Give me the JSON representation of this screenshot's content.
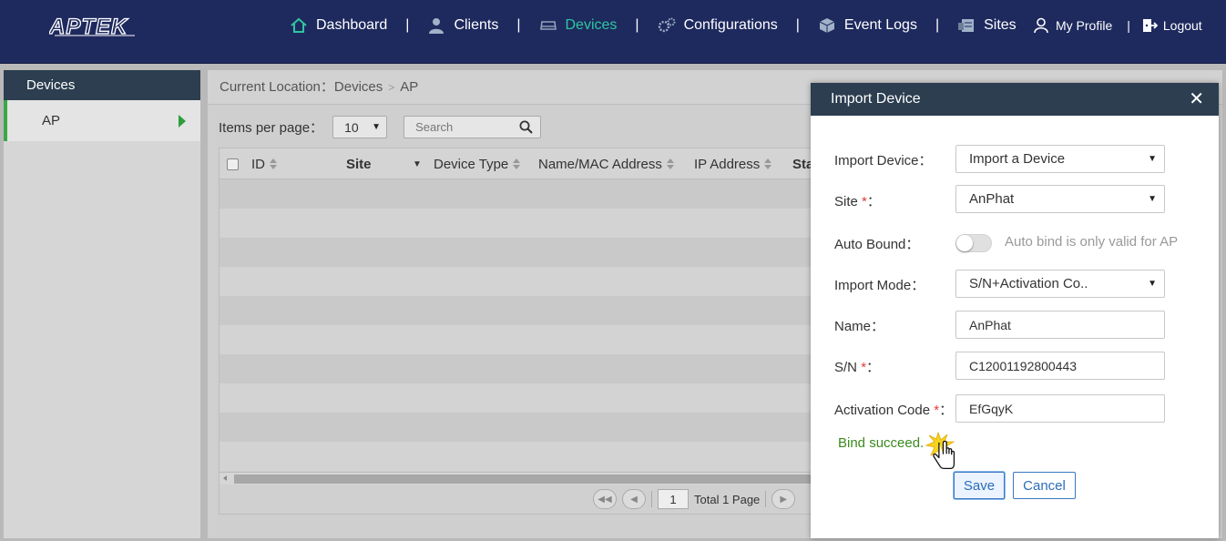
{
  "header": {
    "logo_text": "APTEK",
    "nav": [
      {
        "label": "Dashboard",
        "icon": "home-icon"
      },
      {
        "label": "Clients",
        "icon": "user-icon"
      },
      {
        "label": "Devices",
        "icon": "device-icon",
        "active": true
      },
      {
        "label": "Configurations",
        "icon": "gears-icon"
      },
      {
        "label": "Event Logs",
        "icon": "cube-icon"
      },
      {
        "label": "Sites",
        "icon": "sites-icon"
      }
    ],
    "my_profile": "My Profile",
    "logout": "Logout",
    "accent_color": "#2ec6a0"
  },
  "sidebar": {
    "title": "Devices",
    "items": [
      {
        "label": "AP"
      }
    ]
  },
  "main": {
    "breadcrumb_prefix": "Current Location：",
    "breadcrumb": [
      "Devices",
      "AP"
    ],
    "items_per_page_label": "Items per page：",
    "items_per_page_value": "10",
    "search_placeholder": "Search",
    "columns": [
      "ID",
      "Site",
      "Device Type",
      "Name/MAC Address",
      "IP Address",
      "Sta"
    ],
    "pager": {
      "current_page": "1",
      "total_label": "Total 1 Page"
    }
  },
  "modal": {
    "title": "Import Device",
    "fields": {
      "import_device_label": "Import Device：",
      "import_device_value": "Import a Device",
      "site_label": "Site",
      "site_value": "AnPhat",
      "auto_bound_label": "Auto Bound：",
      "auto_bound_hint": "Auto bind is only valid for AP",
      "import_mode_label": "Import Mode：",
      "import_mode_value": "S/N+Activation Co..",
      "name_label": "Name：",
      "name_value": "AnPhat",
      "sn_label": "S/N",
      "sn_value": "C12001192800443",
      "activation_label": "Activation Code",
      "activation_value": "EfGqyK"
    },
    "required_mark": "*",
    "colon": "：",
    "bind_message": "Bind succeed.",
    "save_label": "Save",
    "cancel_label": "Cancel",
    "close_symbol": "✕"
  }
}
